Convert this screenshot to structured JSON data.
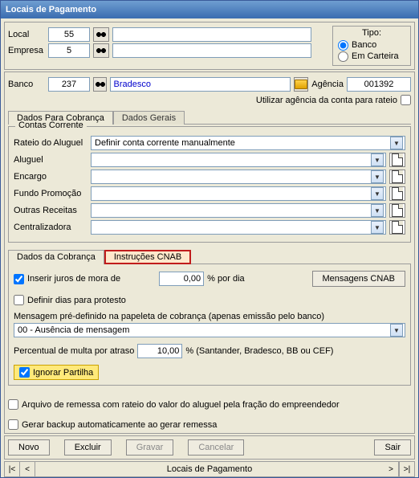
{
  "window_title": "Locais de Pagamento",
  "top": {
    "local_label": "Local",
    "local_value": "55",
    "local_name": "",
    "empresa_label": "Empresa",
    "empresa_value": "5",
    "empresa_name": "",
    "tipo": {
      "title": "Tipo:",
      "banco": "Banco",
      "carteira": "Em Carteira",
      "selected": "banco"
    }
  },
  "banco": {
    "label": "Banco",
    "code": "237",
    "name": "Bradesco",
    "agencia_label": "Agência",
    "agencia": "001392",
    "rateio_label": "Utilizar agência da conta para rateio"
  },
  "tabs": {
    "a": "Dados Para Cobrança",
    "b": "Dados Gerais"
  },
  "contas": {
    "title": "Contas Corrente",
    "rateio_label": "Rateio do Aluguel",
    "rateio_value": "Definir conta corrente manualmente",
    "rows": [
      {
        "label": "Aluguel"
      },
      {
        "label": "Encargo"
      },
      {
        "label": "Fundo Promoção"
      },
      {
        "label": "Outras Receitas"
      },
      {
        "label": "Centralizadora"
      }
    ]
  },
  "innertabs": {
    "a": "Dados da Cobrança",
    "b": "Instruções CNAB"
  },
  "cnab": {
    "juros_label": "Inserir juros de mora de",
    "juros_value": "0,00",
    "juros_unit": "% por dia",
    "mensagens_btn": "Mensagens CNAB",
    "protesto_label": "Definir dias para protesto",
    "msg_label": "Mensagem pré-definido na papeleta de cobrança (apenas emissão pelo banco)",
    "msg_value": "00 - Ausência de mensagem",
    "multa_label": "Percentual de multa por atraso",
    "multa_value": "10,00",
    "multa_unit": "% (Santander, Bradesco, BB ou CEF)",
    "ignorar": "Ignorar Partilha"
  },
  "footer_checks": {
    "a": "Arquivo de remessa com rateio do valor do aluguel pela fração do empreendedor",
    "b": "Gerar backup automaticamente ao gerar remessa"
  },
  "buttons": {
    "novo": "Novo",
    "excluir": "Excluir",
    "gravar": "Gravar",
    "cancelar": "Cancelar",
    "sair": "Sair"
  },
  "nav_title": "Locais de Pagamento"
}
